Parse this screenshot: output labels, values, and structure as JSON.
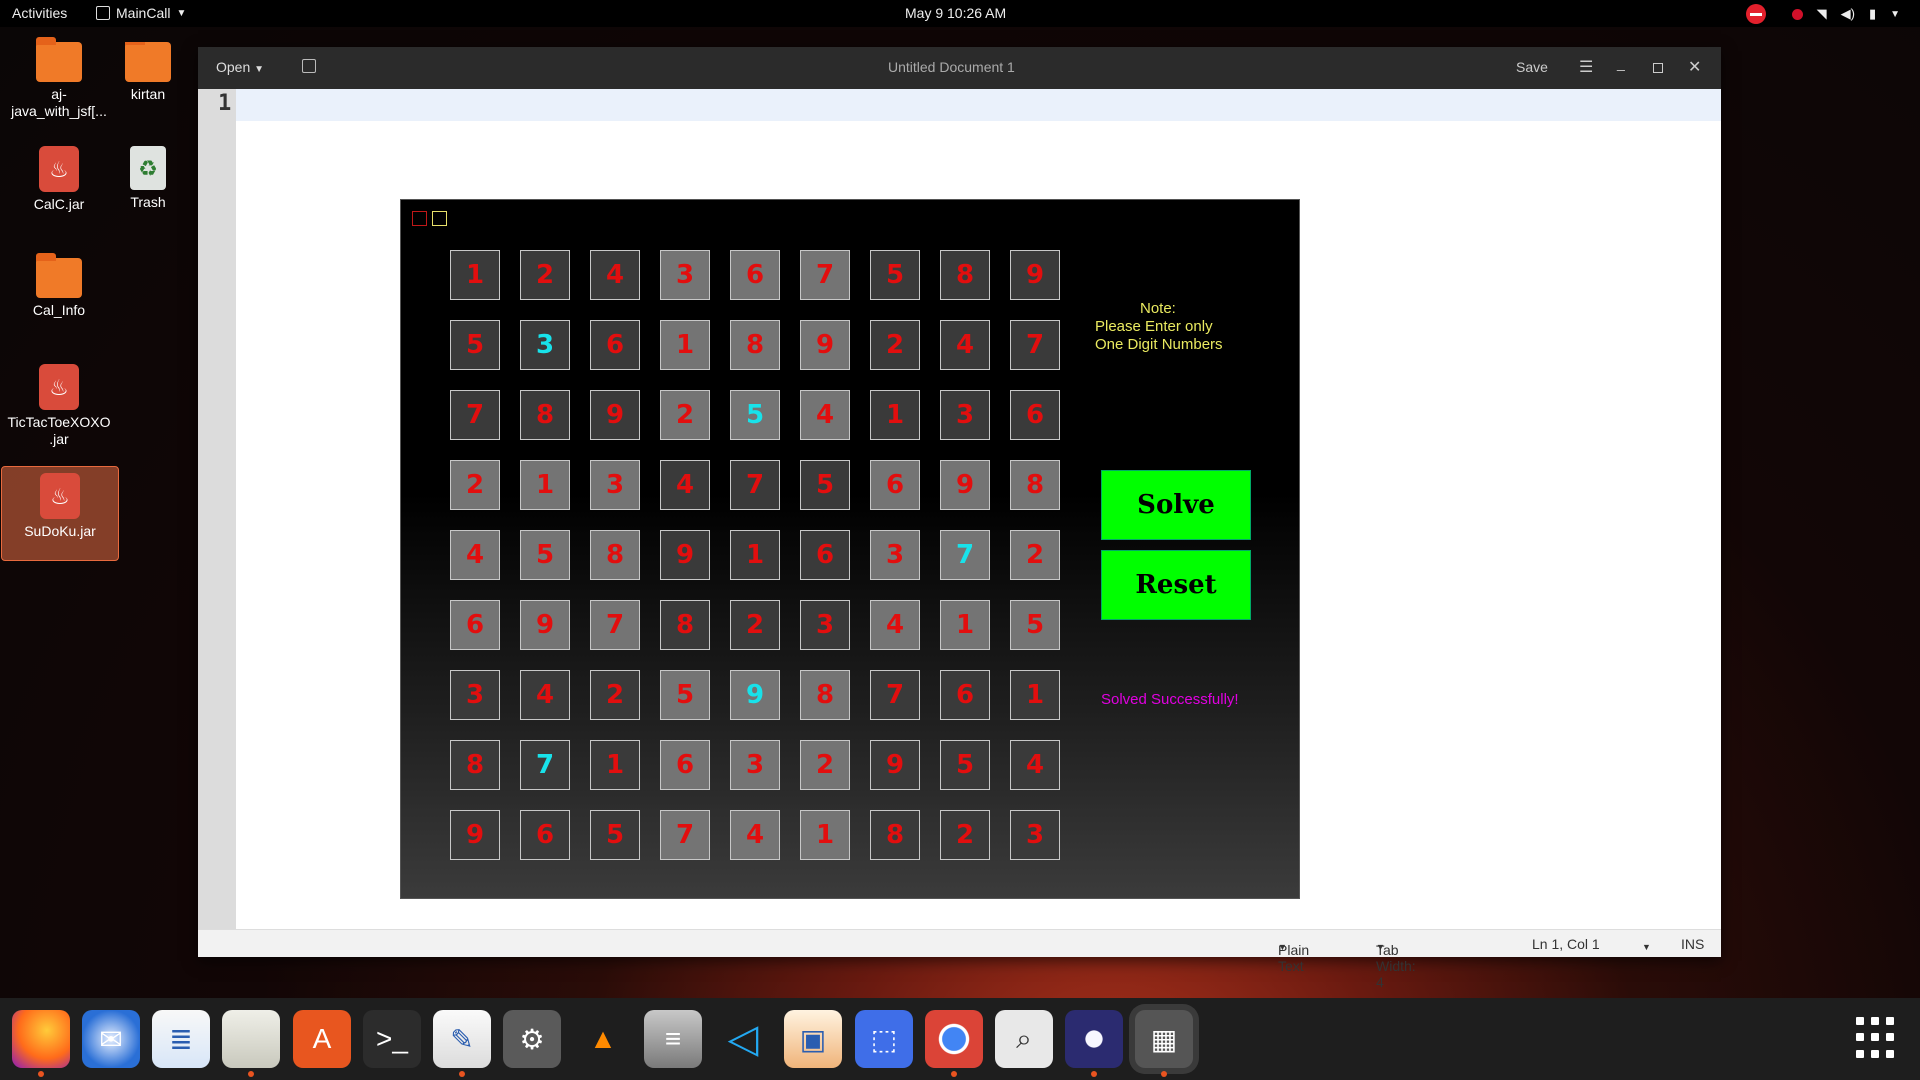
{
  "topbar": {
    "activities": "Activities",
    "app_name": "MainCall",
    "clock": "May 9  10:26 AM"
  },
  "desktop": {
    "icons": [
      {
        "label": "aj-\njava_with_jsf[...",
        "kind": "folder"
      },
      {
        "label": "kirtan",
        "kind": "home-folder"
      },
      {
        "label": "CalC.jar",
        "kind": "jar"
      },
      {
        "label": "Trash",
        "kind": "trash"
      },
      {
        "label": "Cal_Info",
        "kind": "folder"
      },
      {
        "label": "TicTacToeXOXO\n.jar",
        "kind": "jar"
      },
      {
        "label": "SuDoKu.jar",
        "kind": "jar",
        "selected": true
      }
    ]
  },
  "gedit": {
    "open_label": "Open",
    "title": "Untitled Document 1",
    "save_label": "Save",
    "line_number": "1",
    "status": {
      "language": "Plain Text",
      "tab_width": "Tab Width: 4",
      "position": "Ln 1, Col 1",
      "mode": "INS"
    }
  },
  "sudoku": {
    "grid": [
      [
        "1",
        "2",
        "4",
        "3",
        "6",
        "7",
        "5",
        "8",
        "9"
      ],
      [
        "5",
        "3",
        "6",
        "1",
        "8",
        "9",
        "2",
        "4",
        "7"
      ],
      [
        "7",
        "8",
        "9",
        "2",
        "5",
        "4",
        "1",
        "3",
        "6"
      ],
      [
        "2",
        "1",
        "3",
        "4",
        "7",
        "5",
        "6",
        "9",
        "8"
      ],
      [
        "4",
        "5",
        "8",
        "9",
        "1",
        "6",
        "3",
        "7",
        "2"
      ],
      [
        "6",
        "9",
        "7",
        "8",
        "2",
        "3",
        "4",
        "1",
        "5"
      ],
      [
        "3",
        "4",
        "2",
        "5",
        "9",
        "8",
        "7",
        "6",
        "1"
      ],
      [
        "8",
        "7",
        "1",
        "6",
        "3",
        "2",
        "9",
        "5",
        "4"
      ],
      [
        "9",
        "6",
        "5",
        "7",
        "4",
        "1",
        "8",
        "2",
        "3"
      ]
    ],
    "highlighted_cells": [
      [
        1,
        1
      ],
      [
        2,
        4
      ],
      [
        4,
        7
      ],
      [
        6,
        4
      ],
      [
        7,
        1
      ]
    ],
    "note_title": "Note:",
    "note_line1": "Please Enter only",
    "note_line2": "One Digit Numbers",
    "solve_label": "Solve",
    "reset_label": "Reset",
    "status_message": "Solved Successfully!",
    "colors": {
      "digit": "#e20e0e",
      "highlight_digit": "#18e2ea",
      "button": "#00ff00",
      "note": "#eaea60",
      "status": "#e000e0"
    }
  },
  "dock": {
    "apps": [
      "firefox-icon",
      "thunderbird-icon",
      "libreoffice-writer-icon",
      "files-icon",
      "app-center-icon",
      "terminal-icon",
      "text-editor-icon",
      "settings-icon",
      "vlc-icon",
      "database-icon",
      "vscode-icon",
      "libreoffice-impress-icon",
      "screenshot-icon",
      "chrome-icon",
      "search-icon",
      "eclipse-icon",
      "rubik-cube-icon"
    ]
  }
}
